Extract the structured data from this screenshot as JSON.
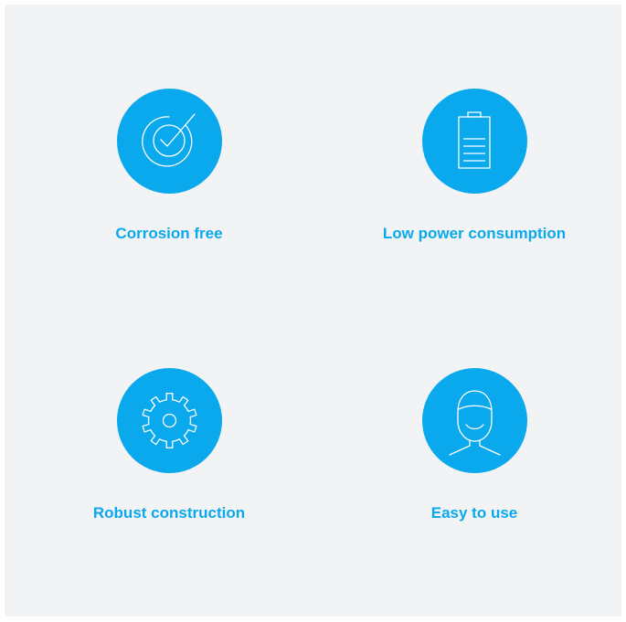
{
  "colors": {
    "accent": "#0aa8ec",
    "background": "#f2f3f5",
    "icon_stroke": "#ffffff"
  },
  "features": [
    {
      "label": "Corrosion free",
      "icon": "target-check-icon"
    },
    {
      "label": "Low power consumption",
      "icon": "battery-icon"
    },
    {
      "label": "Robust construction",
      "icon": "gear-icon"
    },
    {
      "label": "Easy to use",
      "icon": "smiling-face-icon"
    }
  ]
}
